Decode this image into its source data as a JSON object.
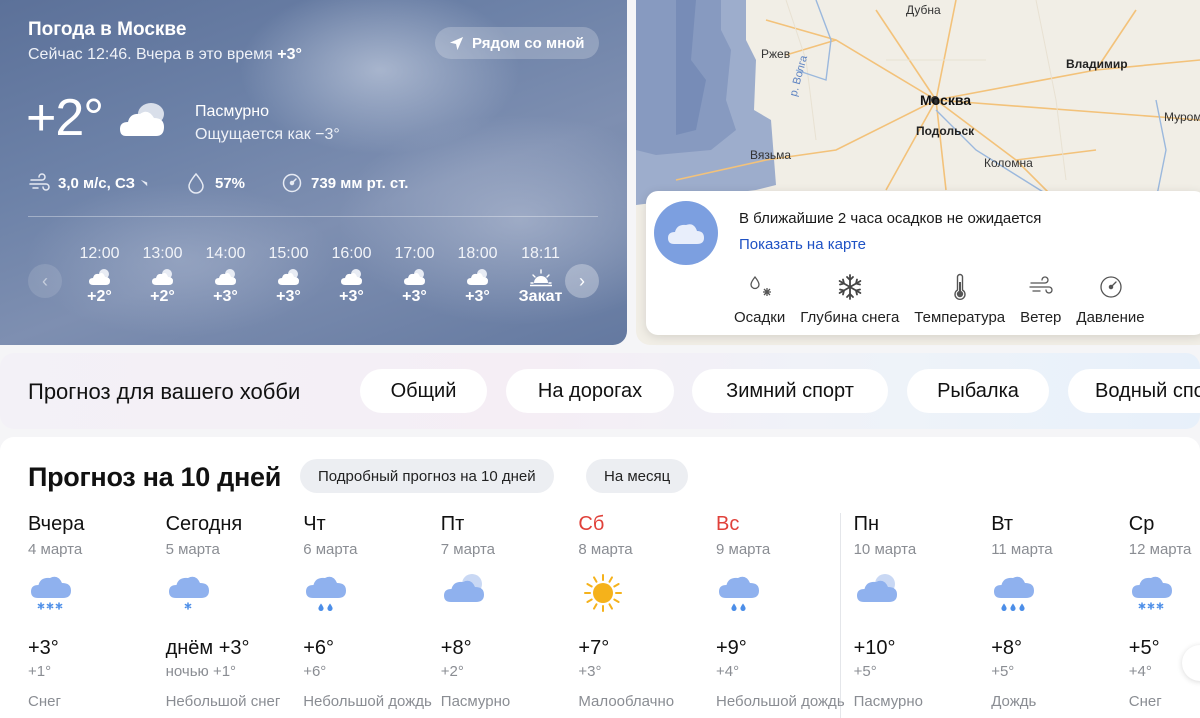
{
  "now": {
    "title": "Погода в Москве",
    "subtitle_prefix": "Сейчас 12:46. Вчера в это время",
    "subtitle_value": "+3°",
    "nearby_label": "Рядом со мной",
    "temperature": "+2°",
    "condition": "Пасмурно",
    "feels_like": "Ощущается как −3°",
    "wind": "3,0 м/с, СЗ",
    "humidity": "57%",
    "pressure": "739 мм рт. ст.",
    "hours": [
      {
        "time": "12:00",
        "temp": "+2°",
        "icon": "cloudy-icon"
      },
      {
        "time": "13:00",
        "temp": "+2°",
        "icon": "cloudy-icon"
      },
      {
        "time": "14:00",
        "temp": "+3°",
        "icon": "cloudy-icon"
      },
      {
        "time": "15:00",
        "temp": "+3°",
        "icon": "cloudy-icon"
      },
      {
        "time": "16:00",
        "temp": "+3°",
        "icon": "cloudy-icon"
      },
      {
        "time": "17:00",
        "temp": "+3°",
        "icon": "cloudy-icon"
      },
      {
        "time": "18:00",
        "temp": "+3°",
        "icon": "cloudy-icon"
      },
      {
        "time": "18:11",
        "temp": "Закат",
        "icon": "sunset-icon"
      }
    ]
  },
  "map": {
    "cities": [
      "Дубна",
      "Ржев",
      "Владимир",
      "Москва",
      "Подольск",
      "Вязьма",
      "Коломна",
      "Муром"
    ],
    "river": "р. Волга",
    "precip_text": "В ближайшие 2 часа осадков не ожидается",
    "precip_link": "Показать на карте",
    "layers": [
      "Осадки",
      "Глубина снега",
      "Температура",
      "Ветер",
      "Давление"
    ]
  },
  "hobby": {
    "title": "Прогноз для вашего хобби",
    "buttons": [
      "Общий",
      "На дорогах",
      "Зимний спорт",
      "Рыбалка",
      "Водный спорт"
    ]
  },
  "forecast": {
    "title": "Прогноз на 10 дней",
    "detailed_label": "Подробный прогноз на 10 дней",
    "month_label": "На месяц",
    "days": [
      {
        "name": "Вчера",
        "date": "4 марта",
        "hi": "+3°",
        "lo": "+1°",
        "cond": "Снег",
        "icon": "snow-icon",
        "weekend": false
      },
      {
        "name": "Сегодня",
        "date": "5 марта",
        "hi": "днём +3°",
        "lo": "ночью +1°",
        "cond": "Небольшой снег",
        "icon": "light-snow-icon",
        "weekend": false
      },
      {
        "name": "Чт",
        "date": "6 марта",
        "hi": "+6°",
        "lo": "+6°",
        "cond": "Небольшой дождь",
        "icon": "rain-icon",
        "weekend": false
      },
      {
        "name": "Пт",
        "date": "7 марта",
        "hi": "+8°",
        "lo": "+2°",
        "cond": "Пасмурно",
        "icon": "overcast-icon",
        "weekend": false
      },
      {
        "name": "Сб",
        "date": "8 марта",
        "hi": "+7°",
        "lo": "+3°",
        "cond": "Малооблачно",
        "icon": "sun-icon",
        "weekend": true
      },
      {
        "name": "Вс",
        "date": "9 марта",
        "hi": "+9°",
        "lo": "+4°",
        "cond": "Небольшой дождь",
        "icon": "rain-icon",
        "weekend": true
      },
      {
        "name": "Пн",
        "date": "10 марта",
        "hi": "+10°",
        "lo": "+5°",
        "cond": "Пасмурно",
        "icon": "overcast-icon",
        "weekend": false
      },
      {
        "name": "Вт",
        "date": "11 марта",
        "hi": "+8°",
        "lo": "+5°",
        "cond": "Дождь",
        "icon": "heavy-rain-icon",
        "weekend": false
      },
      {
        "name": "Ср",
        "date": "12 марта",
        "hi": "+5°",
        "lo": "+4°",
        "cond": "Снег",
        "icon": "snow-icon",
        "weekend": false
      }
    ]
  },
  "colors": {
    "accent_blue": "#1f52c4",
    "weekend_red": "#e0413a",
    "precip_circle": "#7c9fe0"
  }
}
